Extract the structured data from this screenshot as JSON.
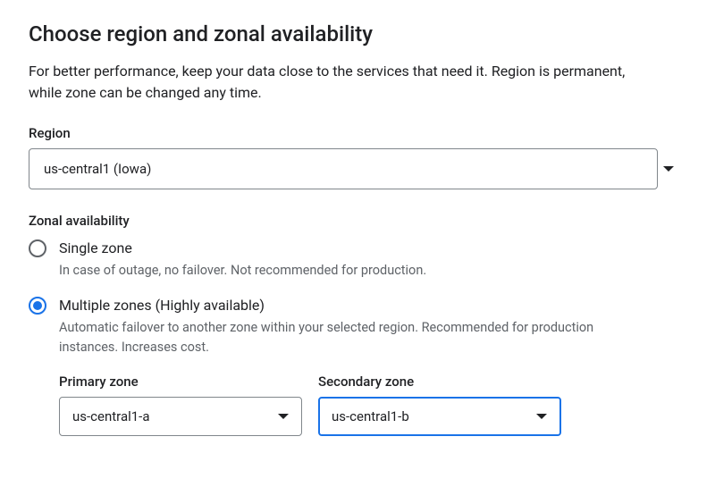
{
  "title": "Choose region and zonal availability",
  "description": "For better performance, keep your data close to the services that need it. Region is permanent, while zone can be changed any time.",
  "region": {
    "label": "Region",
    "value": "us-central1 (Iowa)"
  },
  "zonal": {
    "label": "Zonal availability",
    "options": [
      {
        "id": "single",
        "label": "Single zone",
        "helper": "In case of outage, no failover. Not recommended for production.",
        "checked": false
      },
      {
        "id": "multiple",
        "label": "Multiple zones (Highly available)",
        "helper": "Automatic failover to another zone within your selected region. Recommended for production instances. Increases cost.",
        "checked": true
      }
    ]
  },
  "zones": {
    "primary": {
      "label": "Primary zone",
      "value": "us-central1-a"
    },
    "secondary": {
      "label": "Secondary zone",
      "value": "us-central1-b"
    }
  }
}
